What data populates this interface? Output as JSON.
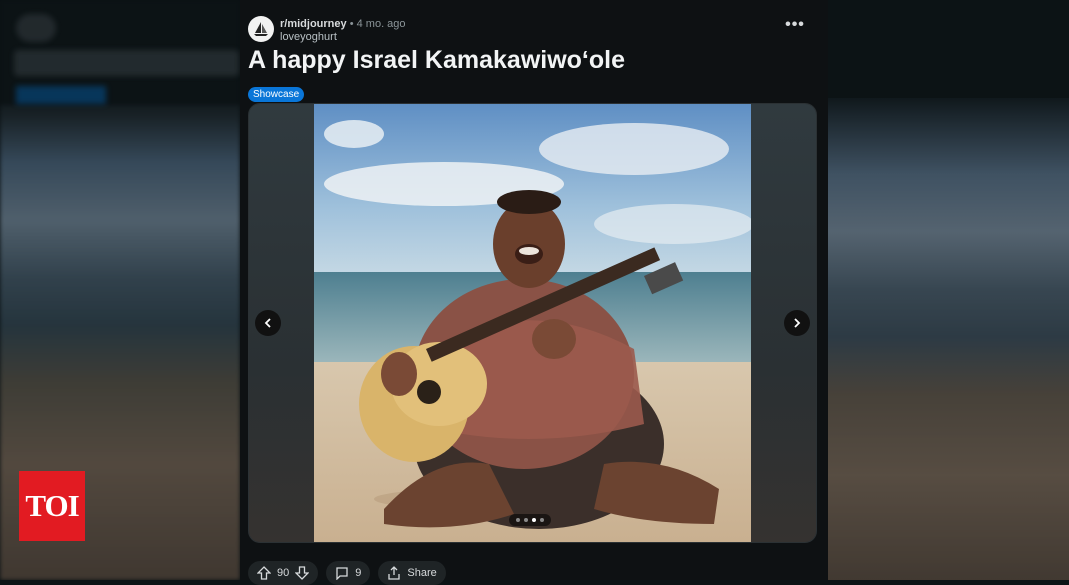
{
  "post": {
    "subreddit": "r/midjourney",
    "separator": "•",
    "time": "4 mo. ago",
    "username": "loveyoghurt",
    "more_label": "•••",
    "title": "A happy Israel Kamakawiwoʻole",
    "flair": "Showcase"
  },
  "gallery": {
    "slide_count": 4,
    "current_slide": 3
  },
  "actions": {
    "upvotes": "90",
    "comments": "9",
    "share": "Share"
  },
  "watermark": {
    "logo_text": "TOI"
  },
  "colors": {
    "flair_bg": "#0a76d8",
    "panel_bg": "#0e1113",
    "logo_bg": "#e21b22"
  }
}
